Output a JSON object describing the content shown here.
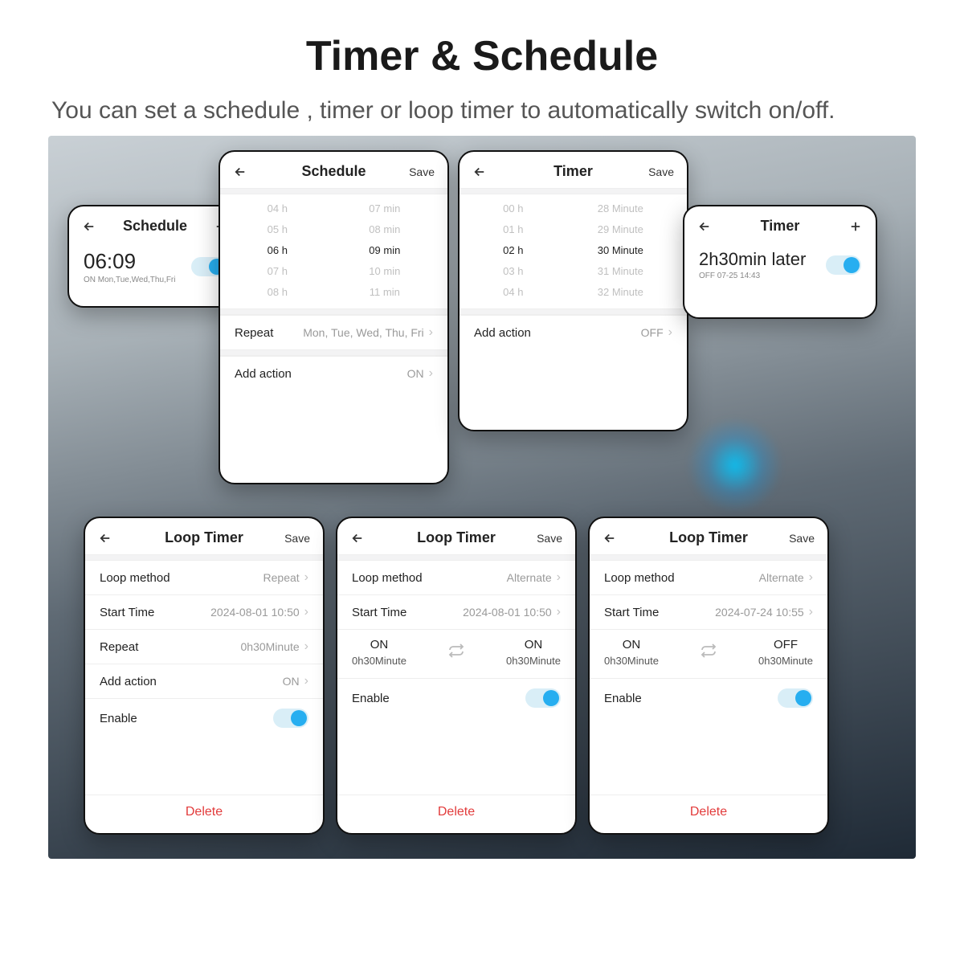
{
  "page": {
    "title": "Timer & Schedule",
    "subtitle": "You can set a schedule , timer or loop timer to automatically switch on/off."
  },
  "common": {
    "save": "Save",
    "delete": "Delete",
    "enable": "Enable",
    "add_action": "Add action",
    "repeat": "Repeat",
    "start_time": "Start Time",
    "loop_method": "Loop method",
    "on": "ON",
    "off": "OFF"
  },
  "sched_mini": {
    "title": "Schedule",
    "time": "06:09",
    "sub": "ON   Mon,Tue,Wed,Thu,Fri"
  },
  "sched": {
    "title": "Schedule",
    "hours": [
      "04 h",
      "05 h",
      "06 h",
      "07 h",
      "08 h"
    ],
    "mins": [
      "07 min",
      "08 min",
      "09 min",
      "10 min",
      "11 min"
    ],
    "sel_h": "06 h",
    "sel_m": "09 min",
    "repeat_val": "Mon, Tue, Wed, Thu, Fri",
    "action_val": "ON"
  },
  "timer": {
    "title": "Timer",
    "hours": [
      "00 h",
      "01 h",
      "02 h",
      "03 h",
      "04 h"
    ],
    "mins": [
      "28 Minute",
      "29 Minute",
      "30 Minute",
      "31 Minute",
      "32 Minute"
    ],
    "sel_h": "02 h",
    "sel_m": "30 Minute",
    "action_val": "OFF"
  },
  "timer_mini": {
    "title": "Timer",
    "time": "2h30min later",
    "sub": "OFF   07-25 14:43"
  },
  "loop1": {
    "title": "Loop Timer",
    "method": "Repeat",
    "start": "2024-08-01 10:50",
    "repeat_val": "0h30Minute",
    "action_val": "ON"
  },
  "loop2": {
    "title": "Loop Timer",
    "method": "Alternate",
    "start": "2024-08-01 10:50",
    "left_state": "ON",
    "left_dur": "0h30Minute",
    "right_state": "ON",
    "right_dur": "0h30Minute"
  },
  "loop3": {
    "title": "Loop Timer",
    "method": "Alternate",
    "start": "2024-07-24 10:55",
    "left_state": "ON",
    "left_dur": "0h30Minute",
    "right_state": "OFF",
    "right_dur": "0h30Minute"
  }
}
